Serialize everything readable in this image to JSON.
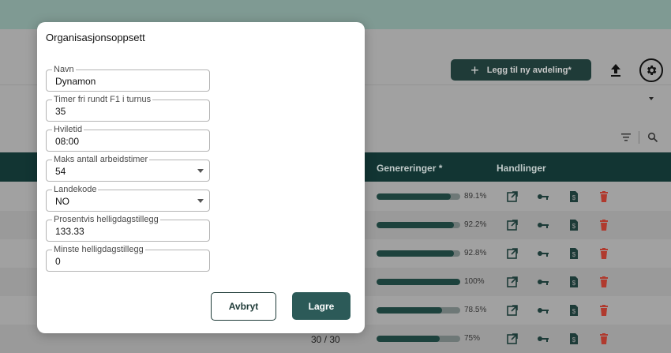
{
  "toolbar": {
    "add_department_label": "Legg til ny avdeling*"
  },
  "table": {
    "headers": {
      "generations": "Genereringer *",
      "actions": "Handlinger"
    },
    "rows": [
      {
        "progress": 89.1,
        "label": "89.1%"
      },
      {
        "progress": 92.2,
        "label": "92.2%"
      },
      {
        "progress": 92.8,
        "label": "92.8%"
      },
      {
        "progress": 100,
        "label": "100%"
      },
      {
        "progress": 78.5,
        "label": "78.5%"
      },
      {
        "progress": 75,
        "label": "75%"
      }
    ],
    "pager_text": "30 / 30"
  },
  "dialog": {
    "title": "Organisasjonsoppsett",
    "fields": [
      {
        "label": "Navn",
        "value": "Dynamon",
        "select": false
      },
      {
        "label": "Timer fri rundt F1 i turnus",
        "value": "35",
        "select": false
      },
      {
        "label": "Hviletid",
        "value": "08:00",
        "select": false
      },
      {
        "label": "Maks antall arbeidstimer",
        "value": "54",
        "select": true
      },
      {
        "label": "Landekode",
        "value": "NO",
        "select": true
      },
      {
        "label": "Prosentvis helligdagstillegg",
        "value": "133.33",
        "select": false
      },
      {
        "label": "Minste helligdagstillegg",
        "value": "0",
        "select": false
      }
    ],
    "cancel_label": "Avbryt",
    "save_label": "Lagre"
  },
  "colors": {
    "primary": "#1f3b38",
    "header": "#123533",
    "danger": "#b03a2e",
    "save": "#2c5a58"
  }
}
